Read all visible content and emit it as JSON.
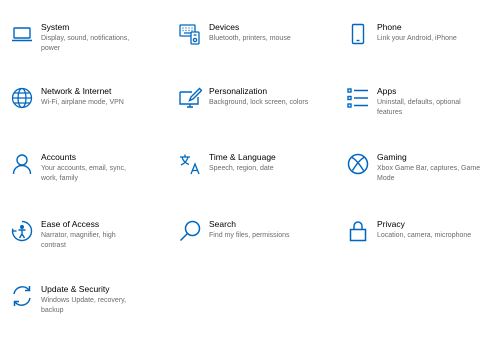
{
  "accent": "#0067c0",
  "items": [
    {
      "icon": "laptop-icon",
      "title": "System",
      "desc": "Display, sound, notifications, power"
    },
    {
      "icon": "keyboard-icon",
      "title": "Devices",
      "desc": "Bluetooth, printers, mouse"
    },
    {
      "icon": "phone-icon",
      "title": "Phone",
      "desc": "Link your Android, iPhone"
    },
    {
      "icon": "globe-icon",
      "title": "Network & Internet",
      "desc": "Wi-Fi, airplane mode, VPN"
    },
    {
      "icon": "pen-monitor-icon",
      "title": "Personalization",
      "desc": "Background, lock screen, colors"
    },
    {
      "icon": "apps-list-icon",
      "title": "Apps",
      "desc": "Uninstall, defaults, optional features"
    },
    {
      "icon": "person-icon",
      "title": "Accounts",
      "desc": "Your accounts, email, sync, work, family"
    },
    {
      "icon": "language-icon",
      "title": "Time & Language",
      "desc": "Speech, region, date"
    },
    {
      "icon": "xbox-icon",
      "title": "Gaming",
      "desc": "Xbox Game Bar, captures, Game Mode"
    },
    {
      "icon": "ease-of-access-icon",
      "title": "Ease of Access",
      "desc": "Narrator, magnifier, high contrast"
    },
    {
      "icon": "search-icon",
      "title": "Search",
      "desc": "Find my files, permissions"
    },
    {
      "icon": "lock-icon",
      "title": "Privacy",
      "desc": "Location, camera, microphone"
    },
    {
      "icon": "sync-icon",
      "title": "Update & Security",
      "desc": "Windows Update, recovery, backup"
    }
  ]
}
